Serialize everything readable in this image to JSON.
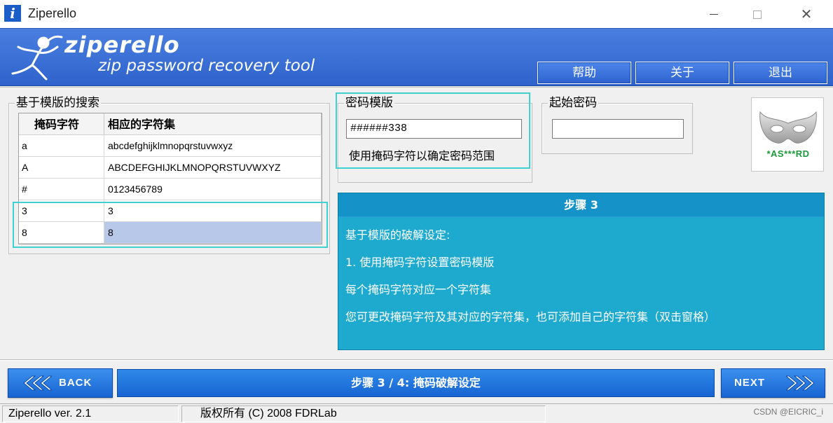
{
  "window": {
    "title": "Ziperello",
    "minimize_icon": "minimize-icon",
    "maximize_icon": "maximize-icon",
    "close_glyph": "✕"
  },
  "header": {
    "logo_name": "ziperello",
    "tagline": "zip password recovery tool",
    "buttons": {
      "help": "帮助",
      "about": "关于",
      "exit": "退出"
    },
    "colors": {
      "banner": "#3a70d8",
      "button": "#3d78e0"
    }
  },
  "template_search": {
    "label": "基于模版的搜索",
    "columns": [
      "掩码字符",
      "相应的字符集"
    ],
    "rows": [
      {
        "mask": "a",
        "charset": "abcdefghijklmnopqrstuvwxyz"
      },
      {
        "mask": "A",
        "charset": "ABCDEFGHIJKLMNOPQRSTUVWXYZ"
      },
      {
        "mask": "#",
        "charset": "0123456789"
      },
      {
        "mask": "3",
        "charset": "3"
      },
      {
        "mask": "8",
        "charset": "8"
      }
    ],
    "selected_row": 4
  },
  "password_template": {
    "label": "密码模版",
    "value": "######338",
    "hint": "使用掩码字符以确定密码范围"
  },
  "start_password": {
    "label": "起始密码",
    "value": ""
  },
  "mask_logo": {
    "text": "*AS***RD",
    "icon": "mask-icon"
  },
  "step_panel": {
    "title": "步骤 3",
    "lines": [
      "基于模版的破解设定:",
      "1. 使用掩码字符设置密码模版",
      "每个掩码字符对应一个字符集",
      "您可更改掩码字符及其对应的字符集，也可添加自己的字符集（双击窗格）"
    ],
    "color": "#1ea9cf"
  },
  "footer": {
    "back_label": "BACK",
    "next_label": "NEXT",
    "step_status": "步骤 3 / 4: 掩码破解设定"
  },
  "statusbar": {
    "version": "Ziperello ver. 2.1",
    "copyright": "版权所有 (C) 2008 FDRLab"
  },
  "watermark": "CSDN @EICRIC_i"
}
